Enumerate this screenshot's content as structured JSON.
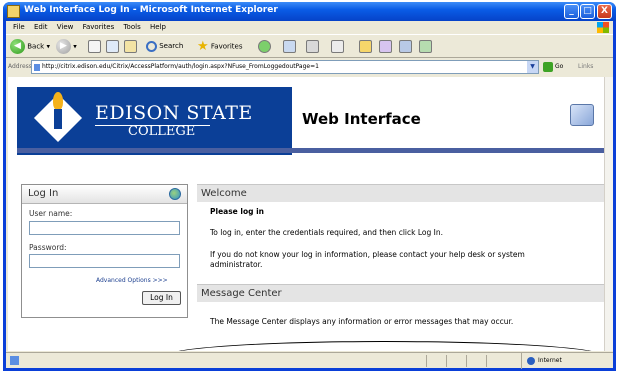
{
  "window": {
    "title": "Web Interface Log In - Microsoft Internet Explorer",
    "controls": [
      "_",
      "□",
      "X"
    ]
  },
  "menu": [
    "File",
    "Edit",
    "View",
    "Favorites",
    "Tools",
    "Help"
  ],
  "toolbar": {
    "back_label": "Back",
    "search_label": "Search",
    "favorites_label": "Favorites"
  },
  "address": {
    "label": "Address",
    "url": "http://citrix.edison.edu/Citrix/AccessPlatform/auth/login.aspx?NFuse_FromLoggedoutPage=1",
    "go_label": "Go",
    "links_label": "Links"
  },
  "banner": {
    "logo_name": "EDISON STATE",
    "logo_sub": "COLLEGE",
    "title": "Web Interface"
  },
  "login": {
    "title": "Log In",
    "username_label": "User name:",
    "password_label": "Password:",
    "username_value": "",
    "password_value": "",
    "advanced_link": "Advanced Options >>>",
    "login_button": "Log In"
  },
  "welcome": {
    "heading": "Welcome",
    "bold": "Please log in",
    "line1": "To log in, enter the credentials required, and then click Log In.",
    "line2": "If you do not know your log in information, please contact your help desk or system",
    "line3": "administrator."
  },
  "message_center": {
    "heading": "Message Center",
    "text": "The Message Center displays any information or error messages that may occur."
  },
  "status": {
    "zone": "Internet"
  }
}
